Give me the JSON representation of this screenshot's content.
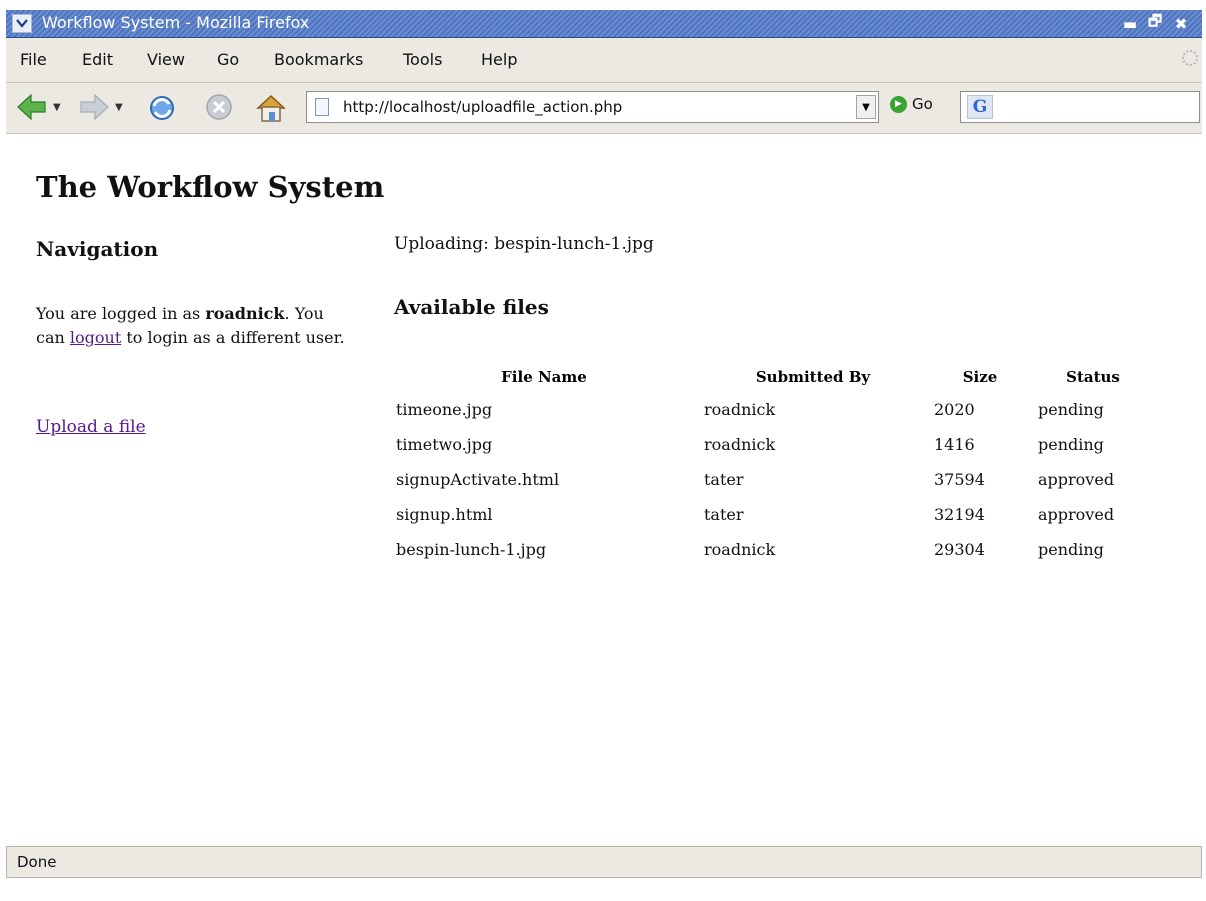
{
  "window": {
    "title": "Workflow System - Mozilla Firefox",
    "controls": {
      "minimize": "▬",
      "maximize": "🗗",
      "close": "✖"
    }
  },
  "menu": {
    "items": [
      "File",
      "Edit",
      "View",
      "Go",
      "Bookmarks",
      "Tools",
      "Help"
    ]
  },
  "toolbar": {
    "icons": [
      "back-icon",
      "forward-icon",
      "reload-icon",
      "stop-icon",
      "home-icon"
    ],
    "url": "http://localhost/uploadfile_action.php",
    "go_label": "Go",
    "search_engine_glyph": "G",
    "search_value": ""
  },
  "page": {
    "title": "The Workflow System",
    "nav_heading": "Navigation",
    "login": {
      "prefix": "You are logged in as ",
      "username": "roadnick",
      "middle": ". You can ",
      "logout_link": "logout",
      "suffix": " to login as a different user."
    },
    "upload_link": "Upload a file",
    "uploading": "Uploading: bespin-lunch-1.jpg",
    "files_heading": "Available files",
    "table": {
      "headers": [
        "File Name",
        "Submitted By",
        "Size",
        "Status"
      ],
      "rows": [
        [
          "timeone.jpg",
          "roadnick",
          "2020",
          "pending"
        ],
        [
          "timetwo.jpg",
          "roadnick",
          "1416",
          "pending"
        ],
        [
          "signupActivate.html",
          "tater",
          "37594",
          "approved"
        ],
        [
          "signup.html",
          "tater",
          "32194",
          "approved"
        ],
        [
          "bespin-lunch-1.jpg",
          "roadnick",
          "29304",
          "pending"
        ]
      ]
    }
  },
  "status": {
    "text": "Done"
  },
  "colors": {
    "titlebar": "#5a7fc6",
    "chrome": "#ece9e3",
    "visited_link": "#551a8b"
  }
}
